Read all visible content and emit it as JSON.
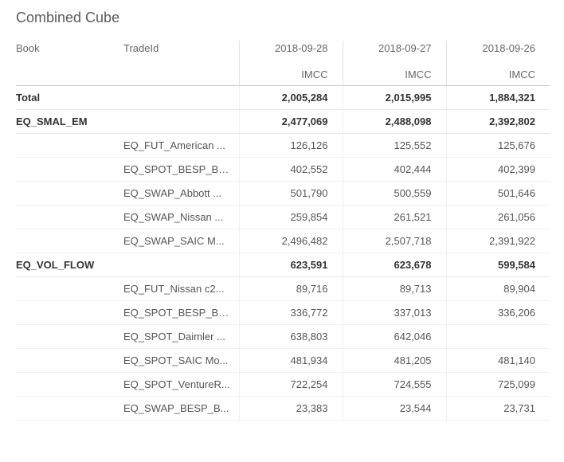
{
  "title": "Combined Cube",
  "columns": {
    "book": "Book",
    "tradeId": "TradeId",
    "dates": [
      "2018-09-28",
      "2018-09-27",
      "2018-09-26"
    ],
    "measure": "IMCC"
  },
  "total": {
    "label": "Total",
    "values": [
      "2,005,284",
      "2,015,995",
      "1,884,321"
    ]
  },
  "groups": [
    {
      "book": "EQ_SMAL_EM",
      "subtotal": [
        "2,477,069",
        "2,488,098",
        "2,392,802"
      ],
      "rows": [
        {
          "tradeId": "EQ_FUT_American ...",
          "values": [
            "126,126",
            "125,552",
            "125,676"
          ]
        },
        {
          "tradeId": "EQ_SPOT_BESP_BA...",
          "values": [
            "402,552",
            "402,444",
            "402,399"
          ]
        },
        {
          "tradeId": "EQ_SWAP_Abbott ...",
          "values": [
            "501,790",
            "500,559",
            "501,646"
          ]
        },
        {
          "tradeId": "EQ_SWAP_Nissan ...",
          "values": [
            "259,854",
            "261,521",
            "261,056"
          ]
        },
        {
          "tradeId": "EQ_SWAP_SAIC M...",
          "values": [
            "2,496,482",
            "2,507,718",
            "2,391,922"
          ]
        }
      ]
    },
    {
      "book": "EQ_VOL_FLOW",
      "subtotal": [
        "623,591",
        "623,678",
        "599,584"
      ],
      "rows": [
        {
          "tradeId": "EQ_FUT_Nissan c2...",
          "values": [
            "89,716",
            "89,713",
            "89,904"
          ]
        },
        {
          "tradeId": "EQ_SPOT_BESP_BA...",
          "values": [
            "336,772",
            "337,013",
            "336,206"
          ]
        },
        {
          "tradeId": "EQ_SPOT_Daimler ...",
          "values": [
            "638,803",
            "642,046",
            ""
          ]
        },
        {
          "tradeId": "EQ_SPOT_SAIC Mo...",
          "values": [
            "481,934",
            "481,205",
            "481,140"
          ]
        },
        {
          "tradeId": "EQ_SPOT_VentureR...",
          "values": [
            "722,254",
            "724,555",
            "725,099"
          ]
        },
        {
          "tradeId": "EQ_SWAP_BESP_B...",
          "values": [
            "23,383",
            "23,544",
            "23,731"
          ]
        }
      ]
    }
  ]
}
